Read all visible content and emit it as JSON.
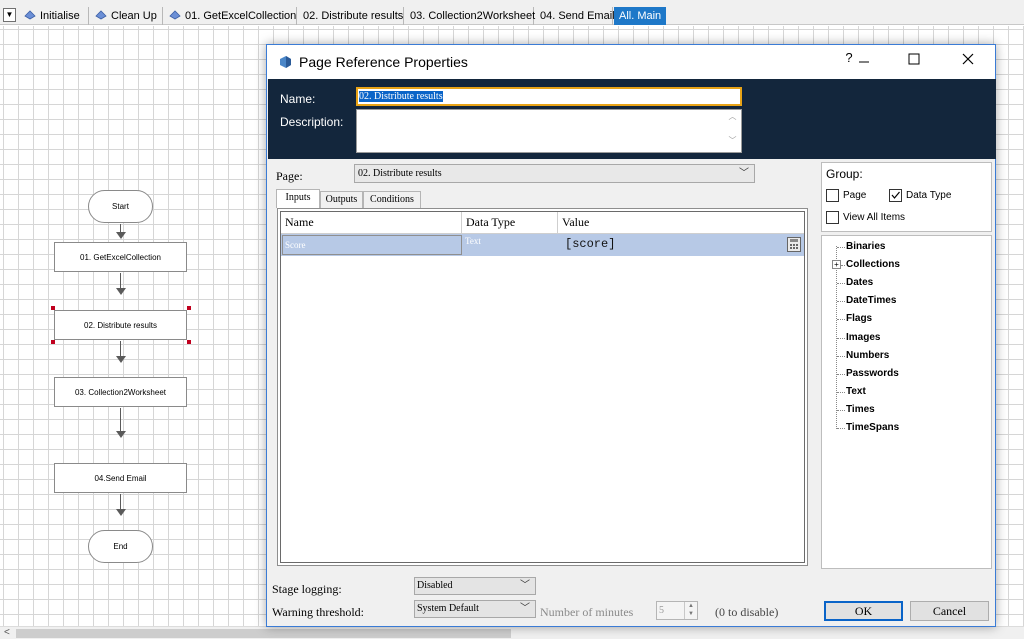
{
  "page_tabs": [
    {
      "label": "Initialise",
      "icon": "subsheet-icon"
    },
    {
      "label": "Clean Up",
      "icon": "subsheet-icon"
    },
    {
      "label": "01. GetExcelCollection",
      "icon": "subsheet-icon"
    },
    {
      "label": "02. Distribute results",
      "icon": null
    },
    {
      "label": "03. Collection2Worksheet",
      "icon": null
    },
    {
      "label": "04. Send Email",
      "icon": null
    },
    {
      "label": "All. Main",
      "icon": null,
      "active": true
    }
  ],
  "flow": {
    "stages": [
      "Start",
      "01. GetExcelCollection",
      "02. Distribute results",
      "03. Collection2Worksheet",
      "04.Send Email",
      "End"
    ]
  },
  "dialog": {
    "title": "Page Reference Properties",
    "help_glyph": "?",
    "name_label": "Name:",
    "name_value": "02. Distribute results",
    "description_label": "Description:",
    "description_value": "",
    "page_label": "Page:",
    "page_value": "02. Distribute results",
    "tabs": [
      "Inputs",
      "Outputs",
      "Conditions"
    ],
    "grid": {
      "columns": [
        "Name",
        "Data Type",
        "Value"
      ],
      "rows": [
        {
          "name": "Score",
          "data_type": "Text",
          "value": "[score]"
        }
      ]
    },
    "group": {
      "label": "Group:",
      "page_option": "Page",
      "page_checked": false,
      "datatype_option": "Data Type",
      "datatype_checked": true,
      "view_all_option": "View All Items",
      "view_all_checked": false
    },
    "data_types": [
      "Binaries",
      "Collections",
      "Dates",
      "DateTimes",
      "Flags",
      "Images",
      "Numbers",
      "Passwords",
      "Text",
      "Times",
      "TimeSpans"
    ],
    "stage_logging_label": "Stage logging:",
    "stage_logging_value": "Disabled",
    "warning_threshold_label": "Warning threshold:",
    "warning_threshold_value": "System Default",
    "minutes_label": "Number of minutes",
    "minutes_value": "5",
    "disable_hint": "(0 to disable)",
    "ok_label": "OK",
    "cancel_label": "Cancel"
  },
  "colors": {
    "header_panel": "#13263c",
    "active_tab": "#1e78c8",
    "selected_row": "#b7c9e6",
    "focus_border": "#e8a317",
    "selection_handle": "#c0001e"
  }
}
